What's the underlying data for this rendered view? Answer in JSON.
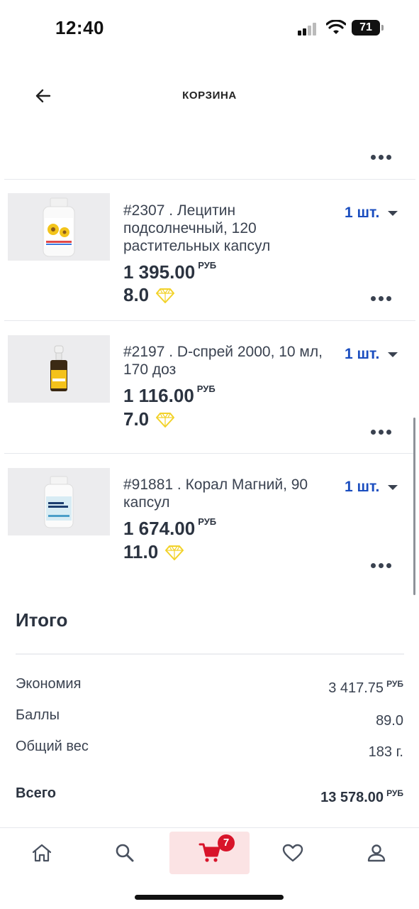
{
  "status": {
    "time": "12:40",
    "battery": "71"
  },
  "header": {
    "title": "КОРЗИНА"
  },
  "items": [
    {
      "title": "#2307 . Лецитин подсолнечный, 120 растительных капсул",
      "qty": "1 шт.",
      "price": "1 395.00",
      "currency": "РУБ",
      "points": "8.0"
    },
    {
      "title": "#2197 . D-спрей 2000, 10 мл, 170 доз",
      "qty": "1 шт.",
      "price": "1 116.00",
      "currency": "РУБ",
      "points": "7.0"
    },
    {
      "title": "#91881 . Корал Магний, 90 капсул",
      "qty": "1 шт.",
      "price": "1 674.00",
      "currency": "РУБ",
      "points": "11.0"
    }
  ],
  "summary": {
    "title": "Итого",
    "economy_label": "Экономия",
    "economy_value": "3 417.75",
    "economy_currency": "РУБ",
    "points_label": "Баллы",
    "points_value": "89.0",
    "weight_label": "Общий вес",
    "weight_value": "183 г.",
    "total_label": "Всего",
    "total_value": "13 578.00",
    "total_currency": "РУБ"
  },
  "nav": {
    "cart_badge": "7"
  },
  "colors": {
    "accent_blue": "#1a4dbf",
    "badge_red": "#d8142a",
    "gem": "#f2d22a"
  }
}
